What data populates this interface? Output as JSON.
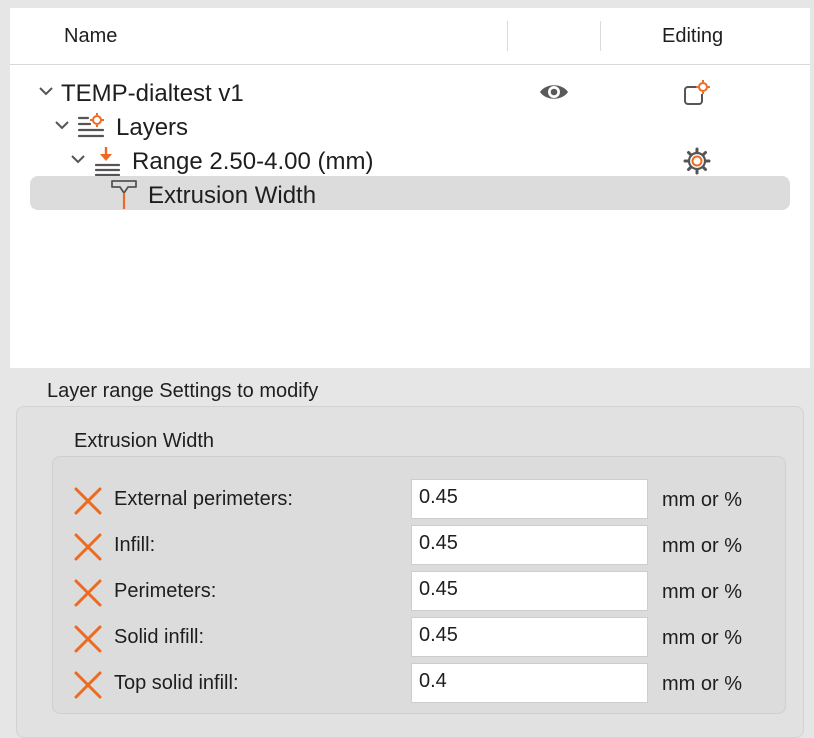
{
  "tree": {
    "columns": {
      "name": "Name",
      "editing": "Editing"
    },
    "items": [
      {
        "label": "TEMP-dialtest v1",
        "icons": [
          "chevron-down-icon",
          "eye-icon",
          "object-settings-icon"
        ]
      },
      {
        "label": "Layers",
        "icons": [
          "chevron-down-icon",
          "layers-icon"
        ]
      },
      {
        "label": "Range 2.50-4.00 (mm)",
        "icons": [
          "chevron-down-icon",
          "layer-range-icon",
          "gear-icon"
        ]
      },
      {
        "label": "Extrusion Width",
        "icons": [
          "extrusion-width-icon"
        ],
        "selected": true
      }
    ]
  },
  "settings": {
    "title": "Layer range Settings to modify",
    "group_title": "Extrusion Width",
    "options": [
      {
        "label": "External perimeters:",
        "value": "0.45",
        "unit": "mm or %"
      },
      {
        "label": "Infill:",
        "value": "0.45",
        "unit": "mm or %"
      },
      {
        "label": "Perimeters:",
        "value": "0.45",
        "unit": "mm or %"
      },
      {
        "label": "Solid infill:",
        "value": "0.45",
        "unit": "mm or %"
      },
      {
        "label": "Top solid infill:",
        "value": "0.4",
        "unit": "mm or %"
      }
    ]
  },
  "colors": {
    "accent": "#ed6b21",
    "selection": "#dcdcdc",
    "icon_gray": "#555555"
  }
}
